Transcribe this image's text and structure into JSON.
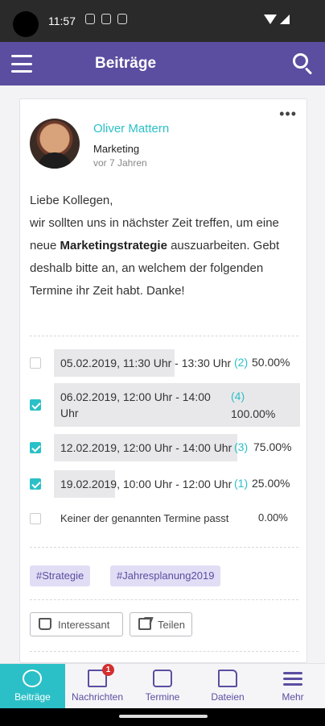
{
  "status_bar": {
    "time": "11:57"
  },
  "app_bar": {
    "title": "Beiträge"
  },
  "post": {
    "author": "Oliver Mattern",
    "department": "Marketing",
    "time_ago": "vor 7 Jahren",
    "greeting": "Liebe Kollegen,",
    "line1": "wir sollten uns in nächster Zeit treffen, um eine neue ",
    "highlight": "Marketingstrategie",
    "line2": " auszuarbeiten. Gebt deshalb bitte an, an welchem der folgenden Termine ihr Zeit habt. Danke!",
    "poll_options": [
      {
        "label": "05.02.2019, 11:30 Uhr - 13:30 Uhr",
        "count": "(2)",
        "percent": "50.00%",
        "checked": false
      },
      {
        "label": "06.02.2019, 12:00 Uhr - 14:00 Uhr",
        "count": "(4)",
        "percent": "100.00%",
        "checked": true
      },
      {
        "label": "12.02.2019, 12:00 Uhr - 14:00 Uhr",
        "count": "(3)",
        "percent": "75.00%",
        "checked": true
      },
      {
        "label": "19.02.2019, 10:00 Uhr - 12:00 Uhr",
        "count": "(1)",
        "percent": "25.00%",
        "checked": true
      },
      {
        "label": "Keiner der genannten Termine passt",
        "count": "",
        "percent": "0.00%",
        "checked": false
      }
    ],
    "tags": [
      "#Strategie",
      "#Jahresplanung2019"
    ],
    "actions": {
      "like": "Interessant",
      "share": "Teilen"
    }
  },
  "bottom_nav": {
    "items": [
      {
        "label": "Beiträge",
        "icon": "posts-icon"
      },
      {
        "label": "Nachrichten",
        "icon": "mail-icon",
        "badge": "1"
      },
      {
        "label": "Termine",
        "icon": "calendar-icon"
      },
      {
        "label": "Dateien",
        "icon": "folder-icon"
      },
      {
        "label": "Mehr",
        "icon": "menu-icon"
      }
    ]
  },
  "colors": {
    "primary": "#5b4ea0",
    "accent": "#2bc0c7",
    "badge": "#d32f2f"
  }
}
